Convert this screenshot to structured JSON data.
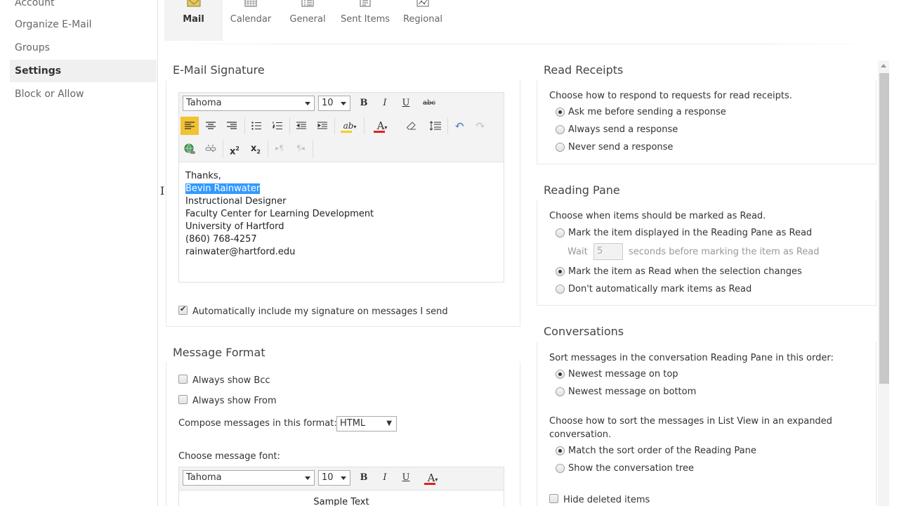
{
  "sidebar": {
    "items": [
      {
        "label": "Account"
      },
      {
        "label": "Organize E-Mail"
      },
      {
        "label": "Groups"
      },
      {
        "label": "Settings"
      },
      {
        "label": "Block or Allow"
      }
    ]
  },
  "tabs": [
    {
      "label": "Mail",
      "icon": "mail-icon"
    },
    {
      "label": "Calendar",
      "icon": "calendar-icon"
    },
    {
      "label": "General",
      "icon": "general-icon"
    },
    {
      "label": "Sent Items",
      "icon": "sent-items-icon"
    },
    {
      "label": "Regional",
      "icon": "regional-icon"
    }
  ],
  "signature": {
    "title": "E-Mail Signature",
    "font": "Tahoma",
    "size": "10",
    "lines": [
      "Thanks,",
      "Bevin Rainwater",
      "Instructional Designer",
      "Faculty Center for Learning Development",
      "University of Hartford",
      "(860) 768-4257",
      "rainwater@hartford.edu"
    ],
    "auto_include_label": "Automatically include my signature on messages I send",
    "auto_include_checked": true
  },
  "message_format": {
    "title": "Message Format",
    "always_bcc": "Always show Bcc",
    "always_from": "Always show From",
    "compose_label": "Compose messages in this format:",
    "compose_value": "HTML",
    "font_label": "Choose message font:",
    "font": "Tahoma",
    "size": "10",
    "sample_text": "Sample Text"
  },
  "read_receipts": {
    "title": "Read Receipts",
    "prompt": "Choose how to respond to requests for read receipts.",
    "options": [
      "Ask me before sending a response",
      "Always send a response",
      "Never send a response"
    ],
    "selected": 0
  },
  "reading_pane": {
    "title": "Reading Pane",
    "prompt": "Choose when items should be marked as Read.",
    "option_displayed": "Mark the item displayed in the Reading Pane as Read",
    "wait_label": "Wait",
    "wait_value": "5",
    "wait_suffix": "seconds before marking the item as Read",
    "option_selection": "Mark the item as Read when the selection changes",
    "option_never": "Don't automatically mark items as Read"
  },
  "conversations": {
    "title": "Conversations",
    "sort_prompt": "Sort messages in the conversation Reading Pane in this order:",
    "sort_options": [
      "Newest message on top",
      "Newest message on bottom"
    ],
    "list_prompt_1": "Choose how to sort the messages in List View in an expanded",
    "list_prompt_2": "conversation.",
    "list_options": [
      "Match the sort order of the Reading Pane",
      "Show the conversation tree"
    ],
    "hide_deleted": "Hide deleted items"
  },
  "colors": {
    "highlight": "#3399ff",
    "active_button": "#f2c230",
    "font_color_bar": "#e02020",
    "highlighter_bar": "#f2d21b"
  }
}
